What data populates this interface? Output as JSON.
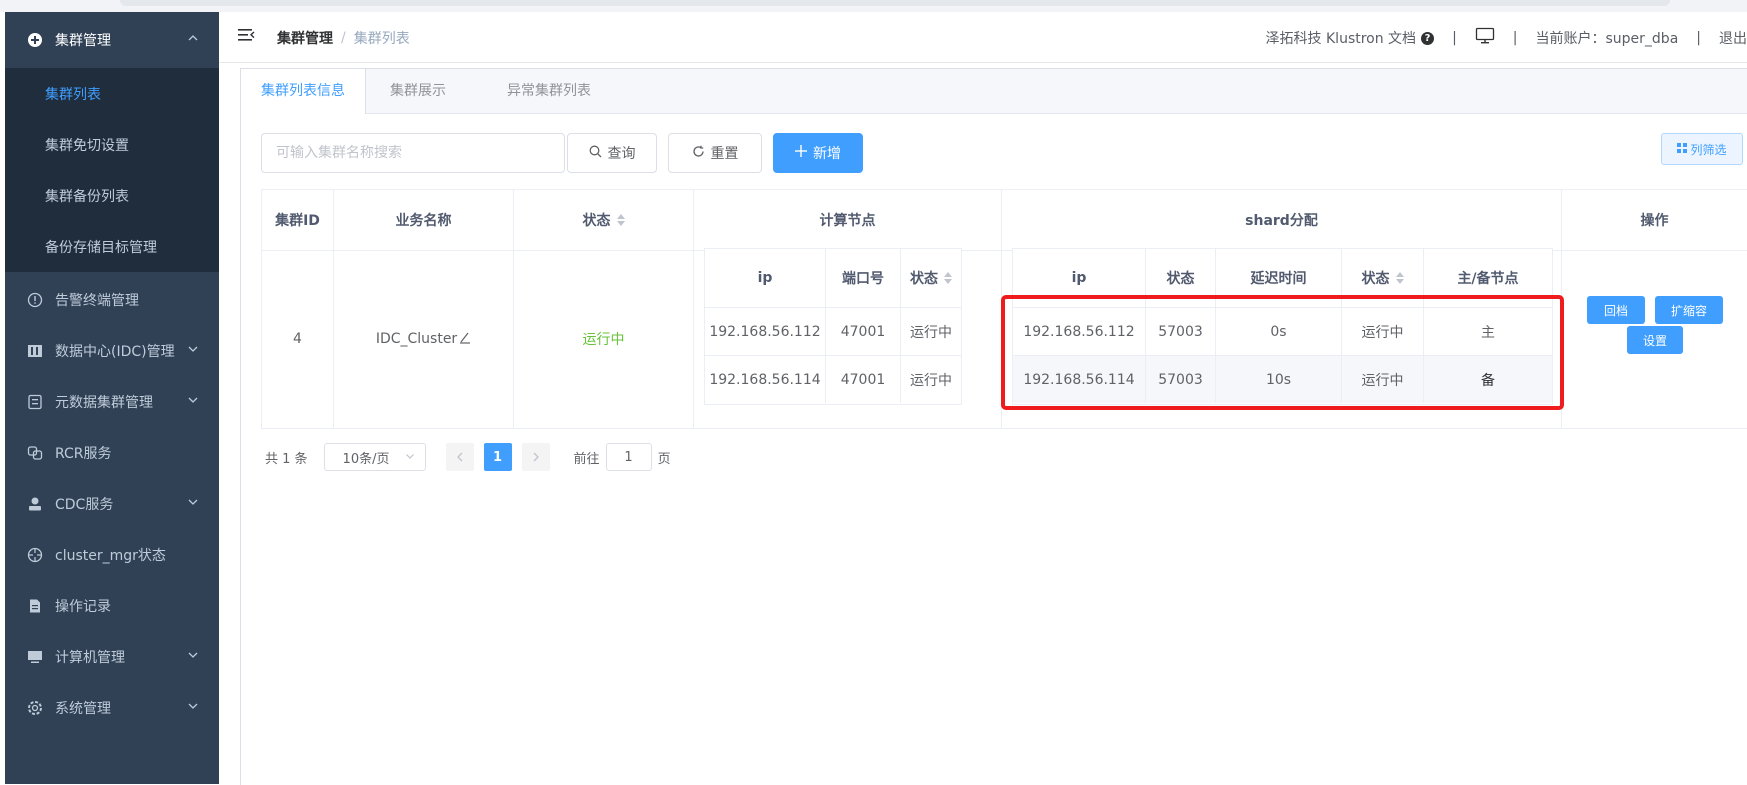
{
  "sidebar": {
    "cluster_group": "集群管理",
    "sub_items": [
      "集群列表",
      "集群免切设置",
      "集群备份列表",
      "备份存储目标管理"
    ],
    "items": [
      "告警终端管理",
      "数据中心(IDC)管理",
      "元数据集群管理",
      "RCR服务",
      "CDC服务",
      "cluster_mgr状态",
      "操作记录",
      "计算机管理",
      "系统管理"
    ]
  },
  "navbar": {
    "breadcrumb_parent": "集群管理",
    "breadcrumb_current": "集群列表",
    "docs_link": "泽拓科技 Klustron 文档",
    "account": "当前账户：super_dba",
    "logout": "退出"
  },
  "tabs": [
    "集群列表信息",
    "集群展示",
    "异常集群列表"
  ],
  "toolbar": {
    "search_placeholder": "可输入集群名称搜索",
    "query": "查询",
    "reset": "重置",
    "add": "新增",
    "column_filter": "列筛选"
  },
  "table": {
    "headers": {
      "cluster_id": "集群ID",
      "business_name": "业务名称",
      "status": "状态",
      "compute_nodes": "计算节点",
      "shard": "shard分配",
      "actions": "操作"
    },
    "row": {
      "cluster_id": "4",
      "business_name": "IDC_Cluster",
      "status": "运行中"
    },
    "compute_headers": [
      "ip",
      "端口号",
      "状态"
    ],
    "compute_rows": [
      [
        "192.168.56.112",
        "47001",
        "运行中"
      ],
      [
        "192.168.56.114",
        "47001",
        "运行中"
      ]
    ],
    "shard_headers": [
      "ip",
      "状态",
      "延迟时间",
      "状态",
      "主/备节点"
    ],
    "shard_rows": [
      [
        "192.168.56.112",
        "57003",
        "0s",
        "运行中",
        "主"
      ],
      [
        "192.168.56.114",
        "57003",
        "10s",
        "运行中",
        "备"
      ]
    ],
    "action_buttons": [
      "回档",
      "扩缩容",
      "设置"
    ]
  },
  "pagination": {
    "total": "共 1 条",
    "page_size": "10条/页",
    "current_page": "1",
    "goto_prefix": "前往",
    "goto_value": "1",
    "goto_suffix": "页"
  },
  "colors": {
    "sidebar_bg": "#304156",
    "submenu_bg": "#1f2d3d",
    "accent": "#409eff",
    "running": "#67c23a",
    "highlight_box": "#ee1c1c"
  }
}
